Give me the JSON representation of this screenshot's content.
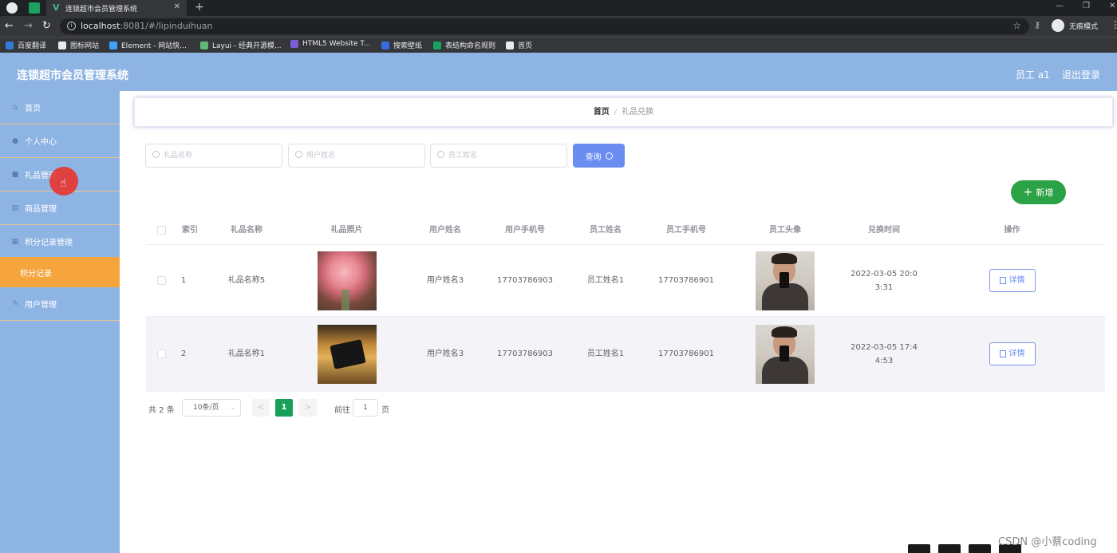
{
  "browser": {
    "tab_title": "连锁超市会员管理系统",
    "url_host": "localhost",
    "url_rest": ":8081/#/lipinduihuan",
    "profile_label": "无痕模式",
    "bookmarks": [
      {
        "label": "百度翻译",
        "color": "#2f7bd8"
      },
      {
        "label": "图标网站",
        "color": "#e8eaed"
      },
      {
        "label": "Element - 网站快...",
        "color": "#409eff"
      },
      {
        "label": "Layui - 经典开源模...",
        "color": "#5fb878"
      },
      {
        "label": "HTML5 Website T...",
        "color": "#7b5fd6"
      },
      {
        "label": "搜索壁纸",
        "color": "#3b6be0"
      },
      {
        "label": "表结构命名规则",
        "color": "#1aa260"
      },
      {
        "label": "首页",
        "color": "#e8eaed"
      }
    ]
  },
  "header": {
    "title": "连锁超市会员管理系统",
    "user": "员工 a1",
    "logout": "退出登录"
  },
  "sidebar": {
    "items": [
      {
        "label": "首页",
        "icon": "home-icon"
      },
      {
        "label": "个人中心",
        "icon": "user-icon"
      },
      {
        "label": "礼品管理",
        "icon": "gift-icon"
      },
      {
        "label": "商品管理",
        "icon": "goods-icon"
      },
      {
        "label": "积分记录管理",
        "icon": "points-icon"
      }
    ],
    "active_sub": "积分记录",
    "last_item": {
      "label": "用户管理",
      "icon": "users-icon"
    }
  },
  "breadcrumb": {
    "home": "首页",
    "separator": "/",
    "current": "礼品兑换"
  },
  "search": {
    "gift_name_placeholder": "礼品名称",
    "user_name_placeholder": "用户姓名",
    "staff_name_placeholder": "员工姓名",
    "query_label": "查询"
  },
  "add_label": "新增",
  "table": {
    "headers": [
      "索引",
      "礼品名称",
      "礼品照片",
      "用户姓名",
      "用户手机号",
      "员工姓名",
      "员工手机号",
      "员工头像",
      "兑换时间",
      "操作"
    ],
    "rows": [
      {
        "index": "1",
        "gift_name": "礼品名称5",
        "photo": "flower-photo",
        "user_name": "用户姓名3",
        "user_phone": "17703786903",
        "staff_name": "员工姓名1",
        "staff_phone": "17703786901",
        "avatar": "staff-avatar-photo",
        "time_line1": "2022-03-05 20:0",
        "time_line2": "3:31",
        "action": "详情"
      },
      {
        "index": "2",
        "gift_name": "礼品名称1",
        "photo": "device-photo",
        "user_name": "用户姓名3",
        "user_phone": "17703786903",
        "staff_name": "员工姓名1",
        "staff_phone": "17703786901",
        "avatar": "staff-avatar-photo",
        "time_line1": "2022-03-05 17:4",
        "time_line2": "4:53",
        "action": "详情"
      }
    ]
  },
  "pagination": {
    "total": "共 2 条",
    "page_size": "10条/页",
    "prev": "<",
    "current": "1",
    "next": ">",
    "goto_label": "前往",
    "goto_value": "1",
    "page_unit": "页"
  },
  "watermark": "CSDN @小蔡coding",
  "colors": {
    "header_bg": "#8eb4e3",
    "active_sub_bg": "#f5a53c",
    "query_btn": "#6b8df2",
    "add_btn": "#2ba245",
    "page_active": "#18a058"
  }
}
